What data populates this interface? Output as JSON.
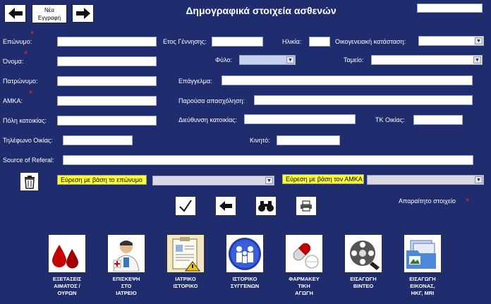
{
  "header": {
    "title": "Δημογραφικά στοιχεία ασθενών",
    "new_entry_line1": "Νέα",
    "new_entry_line2": "Εγγραφή"
  },
  "fields": {
    "surname": "Επώνυμο:",
    "birth_year": "Ετος Γέννησης:",
    "age": "Ηλικία:",
    "marital_status": "Οικογενειακή κατάσταση:",
    "name": "Όνομα:",
    "gender": "Φύλο:",
    "fund": "Ταμείο:",
    "father_name": "Πατρώνυμο:",
    "profession": "Επάγγελμα:",
    "amka": "ΑΜΚΑ:",
    "current_occupation": "Παρούσα απασχόληση:",
    "city": "Πόλη κατοικίας:",
    "address": "Διεύθυνση κατοικίας:",
    "postal_code": "ΤΚ Οικίας:",
    "home_phone": "Τηλέφωνο Οικίας:",
    "mobile": "Κινητό:",
    "referral": "Source of Referal:"
  },
  "search": {
    "by_surname": "Εύρεση με βάση το επώνυμο",
    "by_amka": "Εύρεση με βάση τον ΑΜΚΑ"
  },
  "required_note": "Απαραίτητο στοιχείο",
  "colors": {
    "background": "#1f2d6e",
    "required": "#ff2020",
    "search_label_bg": "#ffff33"
  },
  "tiles": [
    {
      "icon": "blood-drop-icon",
      "label": "ΕΞΕΤΑΣΕΙΣ\nΑΙΜΑΤΟΣ /\nΟΥΡΩΝ"
    },
    {
      "icon": "doctor-icon",
      "label": "ΕΠΙΣΚΕΨΗ\nΣΤΟ\nΙΑΤΡΕΙΟ"
    },
    {
      "icon": "medical-record-icon",
      "label": "ΙΑΤΡΙΚΟ\nΙΣΤΟΡΙΚΟ"
    },
    {
      "icon": "family-icon",
      "label": "ΙΣΤΟΡΙΚΟ\nΣΥΓΓΕΝΩΝ"
    },
    {
      "icon": "pills-icon",
      "label": "ΦΑΡΜΑΚΕΥ\nΤΙΚΗ\nΑΓΩΓΗ"
    },
    {
      "icon": "film-reel-icon",
      "label": "ΕΙΣΑΓΩΓΗ\nΒΙΝΤΕΟ"
    },
    {
      "icon": "image-folder-icon",
      "label": "ΕΙΣΑΓΩΓΗ\nΕΙΚΟΝΑΣ,\nΗΚΓ, MRI"
    }
  ]
}
